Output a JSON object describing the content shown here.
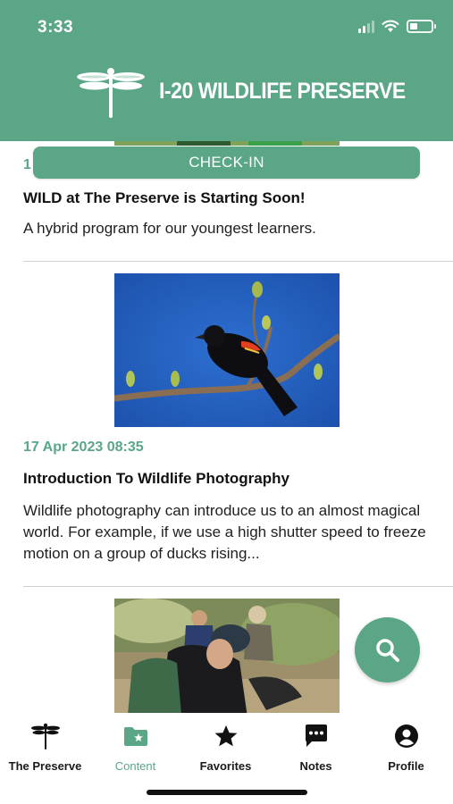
{
  "status": {
    "time": "3:33"
  },
  "header": {
    "title": "I-20 WILDLIFE PRESERVE",
    "logo": "dragonfly-logo",
    "color": "#5aa687"
  },
  "checkin": {
    "label": "CHECK-IN"
  },
  "feed": {
    "items": [
      {
        "date": "1",
        "title": "WILD at The Preserve is Starting Soon!",
        "description": "A hybrid program for our youngest learners.",
        "image": "wildlife-photo"
      },
      {
        "date": "17 Apr 2023 08:35",
        "title": "Introduction To Wildlife Photography",
        "description": "Wildlife photography can introduce us to an almost magical world. For example, if we use a high shutter speed to freeze motion on a group of ducks rising...",
        "image": "red-winged-blackbird-photo"
      },
      {
        "image": "field-researchers-photo"
      }
    ]
  },
  "fab": {
    "icon": "search-icon"
  },
  "tabs": [
    {
      "label": "The Preserve",
      "icon": "dragonfly-icon",
      "active": false
    },
    {
      "label": "Content",
      "icon": "folder-star-icon",
      "active": true
    },
    {
      "label": "Favorites",
      "icon": "star-icon",
      "active": false
    },
    {
      "label": "Notes",
      "icon": "chat-bubble-icon",
      "active": false
    },
    {
      "label": "Profile",
      "icon": "user-circle-icon",
      "active": false
    }
  ]
}
